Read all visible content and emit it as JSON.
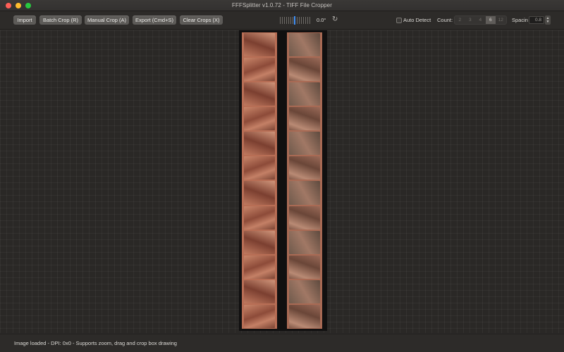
{
  "window": {
    "title": "FFFSplitter v1.0.72 - TIFF File Cropper"
  },
  "toolbar": {
    "import_label": "Import",
    "batch_crop_label": "Batch Crop (R)",
    "manual_crop_label": "Manual Crop (A)",
    "export_label": "Export (Cmd+S)",
    "clear_crops_label": "Clear Crops (X)",
    "rotation_value": "0.0°",
    "auto_detect_label": "Auto Detect",
    "auto_detect_checked": false,
    "count_label": "Count:",
    "count_options": [
      "2",
      "3",
      "4",
      "6",
      "12"
    ],
    "count_selected": "6",
    "spacing_label": "Spacin",
    "spacing_value": "0.8"
  },
  "status": {
    "text": "Image loaded - DPI: 0x0 - Supports zoom, drag and crop box drawing"
  },
  "colors": {
    "accent": "#3f8ff5",
    "button_bg": "#5d5b58",
    "canvas_bg": "#2a2826",
    "film_base": "#b86e55"
  },
  "icons": {
    "rotate": "rotate-icon",
    "stepper": "stepper-icon"
  }
}
